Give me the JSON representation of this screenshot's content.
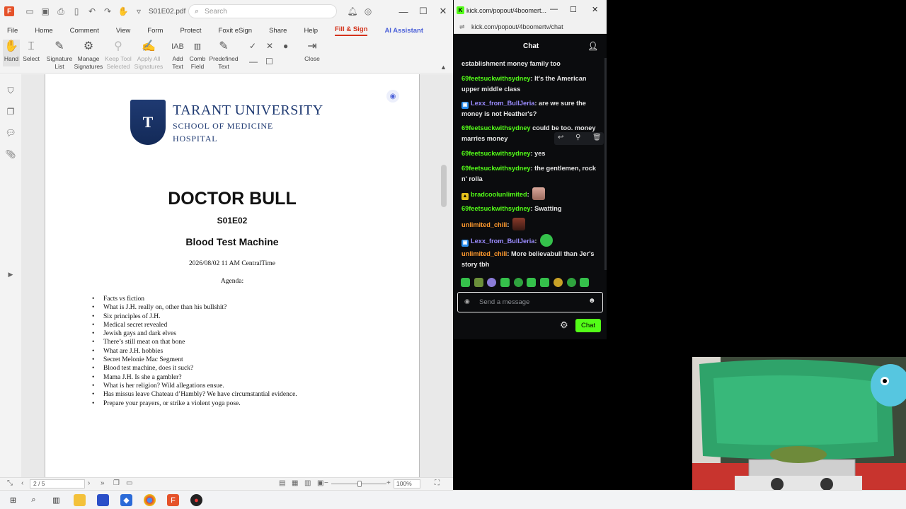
{
  "pdf": {
    "doc_name": "S01E02.pdf",
    "search_placeholder": "Search",
    "menu": [
      "File",
      "Home",
      "Comment",
      "View",
      "Form",
      "Protect",
      "Foxit eSign",
      "Share",
      "Help",
      "Fill & Sign",
      "AI Assistant"
    ],
    "ribbon": {
      "hand": "Hand",
      "select": "Select",
      "signature_list_1": "Signature",
      "signature_list_2": "List",
      "manage_1": "Manage",
      "manage_2": "Signatures",
      "keep_1": "Keep Tool",
      "keep_2": "Selected",
      "apply_1": "Apply All",
      "apply_2": "Signatures",
      "add_1": "Add",
      "add_2": "Text",
      "comb_1": "Comb",
      "comb_2": "Field",
      "predef_1": "Predefined",
      "predef_2": "Text",
      "close": "Close"
    },
    "page": {
      "university": "TARANT UNIVERSITY",
      "school": "SCHOOL OF MEDICINE",
      "hospital": "HOSPITAL",
      "title": "DOCTOR BULL",
      "episode": "S01E02",
      "subtitle": "Blood Test Machine",
      "date": "2026/08/02 11 AM CentralTime",
      "agenda_label": "Agenda:",
      "agenda": [
        "Facts vs fiction",
        "What is J.H. really on, other than his bullshit?",
        "Six principles of J.H.",
        "Medical secret revealed",
        "Jewish gays and dark elves",
        "There’s still meat on that bone",
        "What are J.H. hobbies",
        "Secret Melonie Mac Segment",
        "Blood test machine, does it suck?",
        "Mama J.H. Is she a gambler?",
        "What is her religion? Wild allegations ensue.",
        "Has missus leave Chateau d’Hambly? We have circumstantial evidence.",
        "Prepare your prayers, or strike a violent yoga pose."
      ]
    },
    "status": {
      "page_indicator": "2 / 5",
      "zoom": "100%"
    }
  },
  "chat_window": {
    "title": "kick.com/popout/4boomert...",
    "url": "kick.com/popout/4boomertv/chat",
    "header": "Chat",
    "input_placeholder": "Send a message",
    "send_label": "Chat",
    "messages": [
      {
        "user": "",
        "text": "establishment money family too"
      },
      {
        "user": "69feetsuckwithsydney",
        "text": ": It's the American upper middle class"
      },
      {
        "user": "Lexx_from_BullJeria",
        "text": ": are we sure the money is not Heather's?"
      },
      {
        "user": "69feetsuckwithsydney",
        "text": " could be too. money marries money"
      },
      {
        "user": "69feetsuckwithsydney",
        "text": ": yes"
      },
      {
        "user": "69feetsuckwithsydney",
        "text": ": the gentlemen, rock n' rolla"
      },
      {
        "user": "bradcoolunlimited",
        "text": ":"
      },
      {
        "user": "69feetsuckwithsydney",
        "text": ": Swatting"
      },
      {
        "user": "unlimited_chili",
        "text": ":"
      },
      {
        "user": "Lexx_from_BullJeria",
        "text": ":"
      },
      {
        "user": "unlimited_chili",
        "text": ": More believabull than Jer's story tbh"
      }
    ],
    "colors": {
      "green_user": "#53fc18",
      "purple_user": "#9b8cff",
      "orange_user": "#ff9a2e",
      "accent": "#53fc18"
    }
  }
}
